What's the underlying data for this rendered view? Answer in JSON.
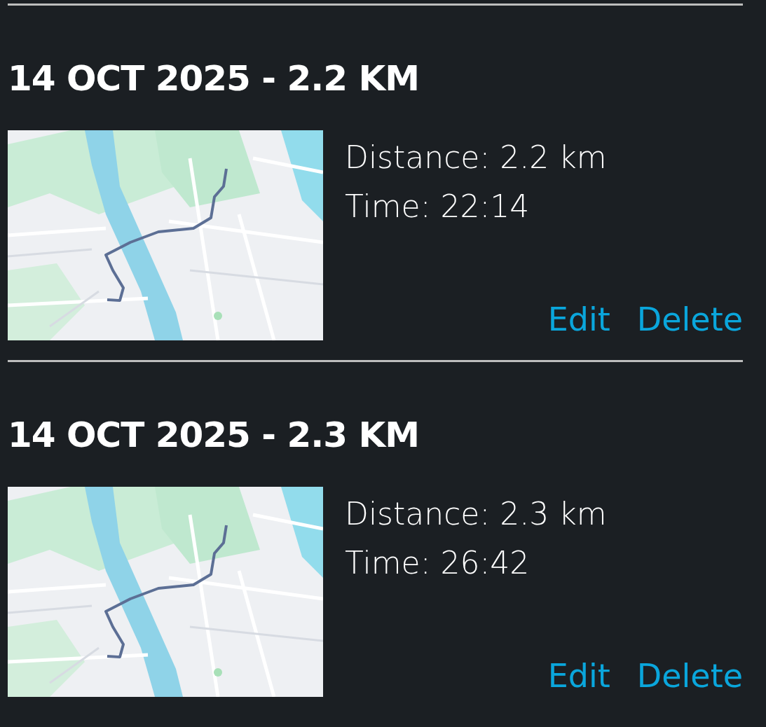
{
  "entries": [
    {
      "title": "14 OCT 2025 - 2.2 KM",
      "distance": "Distance: 2.2 km",
      "time": "Time: 22:14",
      "actions": [
        "Edit",
        "Delete"
      ]
    },
    {
      "title": "14 OCT 2025 - 2.3 KM",
      "distance": "Distance: 2.3 km",
      "time": "Time: 26:42",
      "actions": [
        "Edit",
        "Delete"
      ]
    }
  ]
}
